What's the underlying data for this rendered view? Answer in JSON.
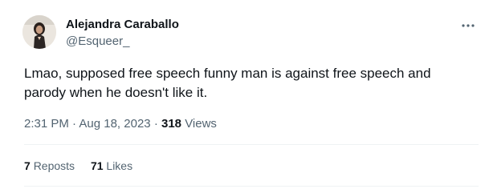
{
  "author": {
    "display_name": "Alejandra Caraballo",
    "handle": "@Esqueer_"
  },
  "tweet": {
    "text": "Lmao, supposed free speech funny man is against free speech and parody when he doesn't like it.",
    "time": "2:31 PM",
    "separator": "·",
    "date": "Aug 18, 2023",
    "views_count": "318",
    "views_label": "Views"
  },
  "stats": {
    "reposts_count": "7",
    "reposts_label": "Reposts",
    "likes_count": "71",
    "likes_label": "Likes"
  },
  "icons": {
    "more": "more-horizontal-icon"
  },
  "colors": {
    "primary_text": "#0f1419",
    "secondary_text": "#536471",
    "divider": "#eff3f4"
  }
}
